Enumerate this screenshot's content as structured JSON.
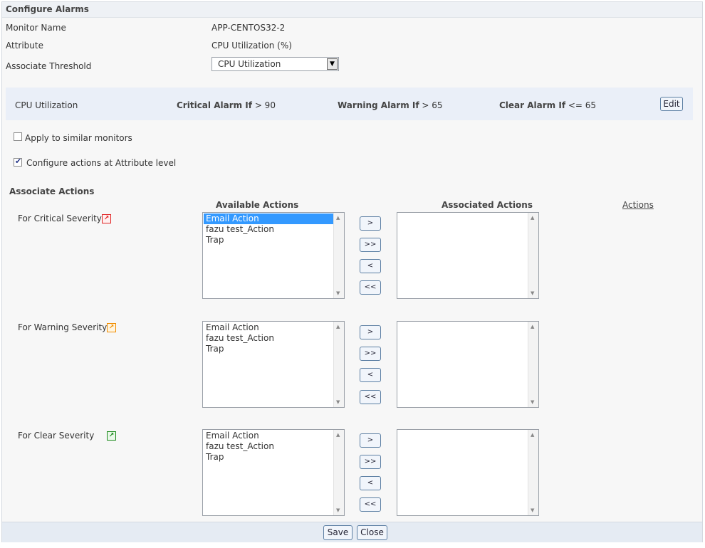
{
  "title": "Configure Alarms",
  "form": {
    "monitor_name_label": "Monitor Name",
    "monitor_name_value": "APP-CENTOS32-2",
    "attribute_label": "Attribute",
    "attribute_value": "CPU Utilization (%)",
    "threshold_label": "Associate Threshold",
    "threshold_selected": "CPU Utilization"
  },
  "threshold": {
    "name": "CPU Utilization",
    "critical_label": "Critical Alarm If",
    "critical_cond": "> 90",
    "warning_label": "Warning Alarm If",
    "warning_cond": "> 65",
    "clear_label": "Clear Alarm If",
    "clear_cond": "<= 65",
    "edit_label": "Edit"
  },
  "options": {
    "apply_similar_label": "Apply to similar monitors",
    "apply_similar_checked": false,
    "configure_attr_label": "Configure actions at Attribute level",
    "configure_attr_checked": true
  },
  "actions": {
    "section_title": "Associate Actions",
    "available_header": "Available Actions",
    "associated_header": "Associated Actions",
    "actions_link": "Actions",
    "move_right": ">",
    "move_all_right": ">>",
    "move_left": "<",
    "move_all_left": "<<",
    "rows": [
      {
        "label": "For Critical Severity",
        "color": "#e02020",
        "available": [
          "Email Action",
          "fazu test_Action",
          "Trap"
        ],
        "selected": "Email Action",
        "associated": []
      },
      {
        "label": "For Warning Severity",
        "color": "#f08c00",
        "available": [
          "Email Action",
          "fazu test_Action",
          "Trap"
        ],
        "selected": "",
        "associated": []
      },
      {
        "label": "For Clear Severity",
        "color": "#1a8a1a",
        "available": [
          "Email Action",
          "fazu test_Action",
          "Trap"
        ],
        "selected": "",
        "associated": []
      }
    ]
  },
  "footer": {
    "save_label": "Save",
    "close_label": "Close"
  },
  "colors": {
    "band": "#eaeff8",
    "selection": "#3399ff"
  }
}
